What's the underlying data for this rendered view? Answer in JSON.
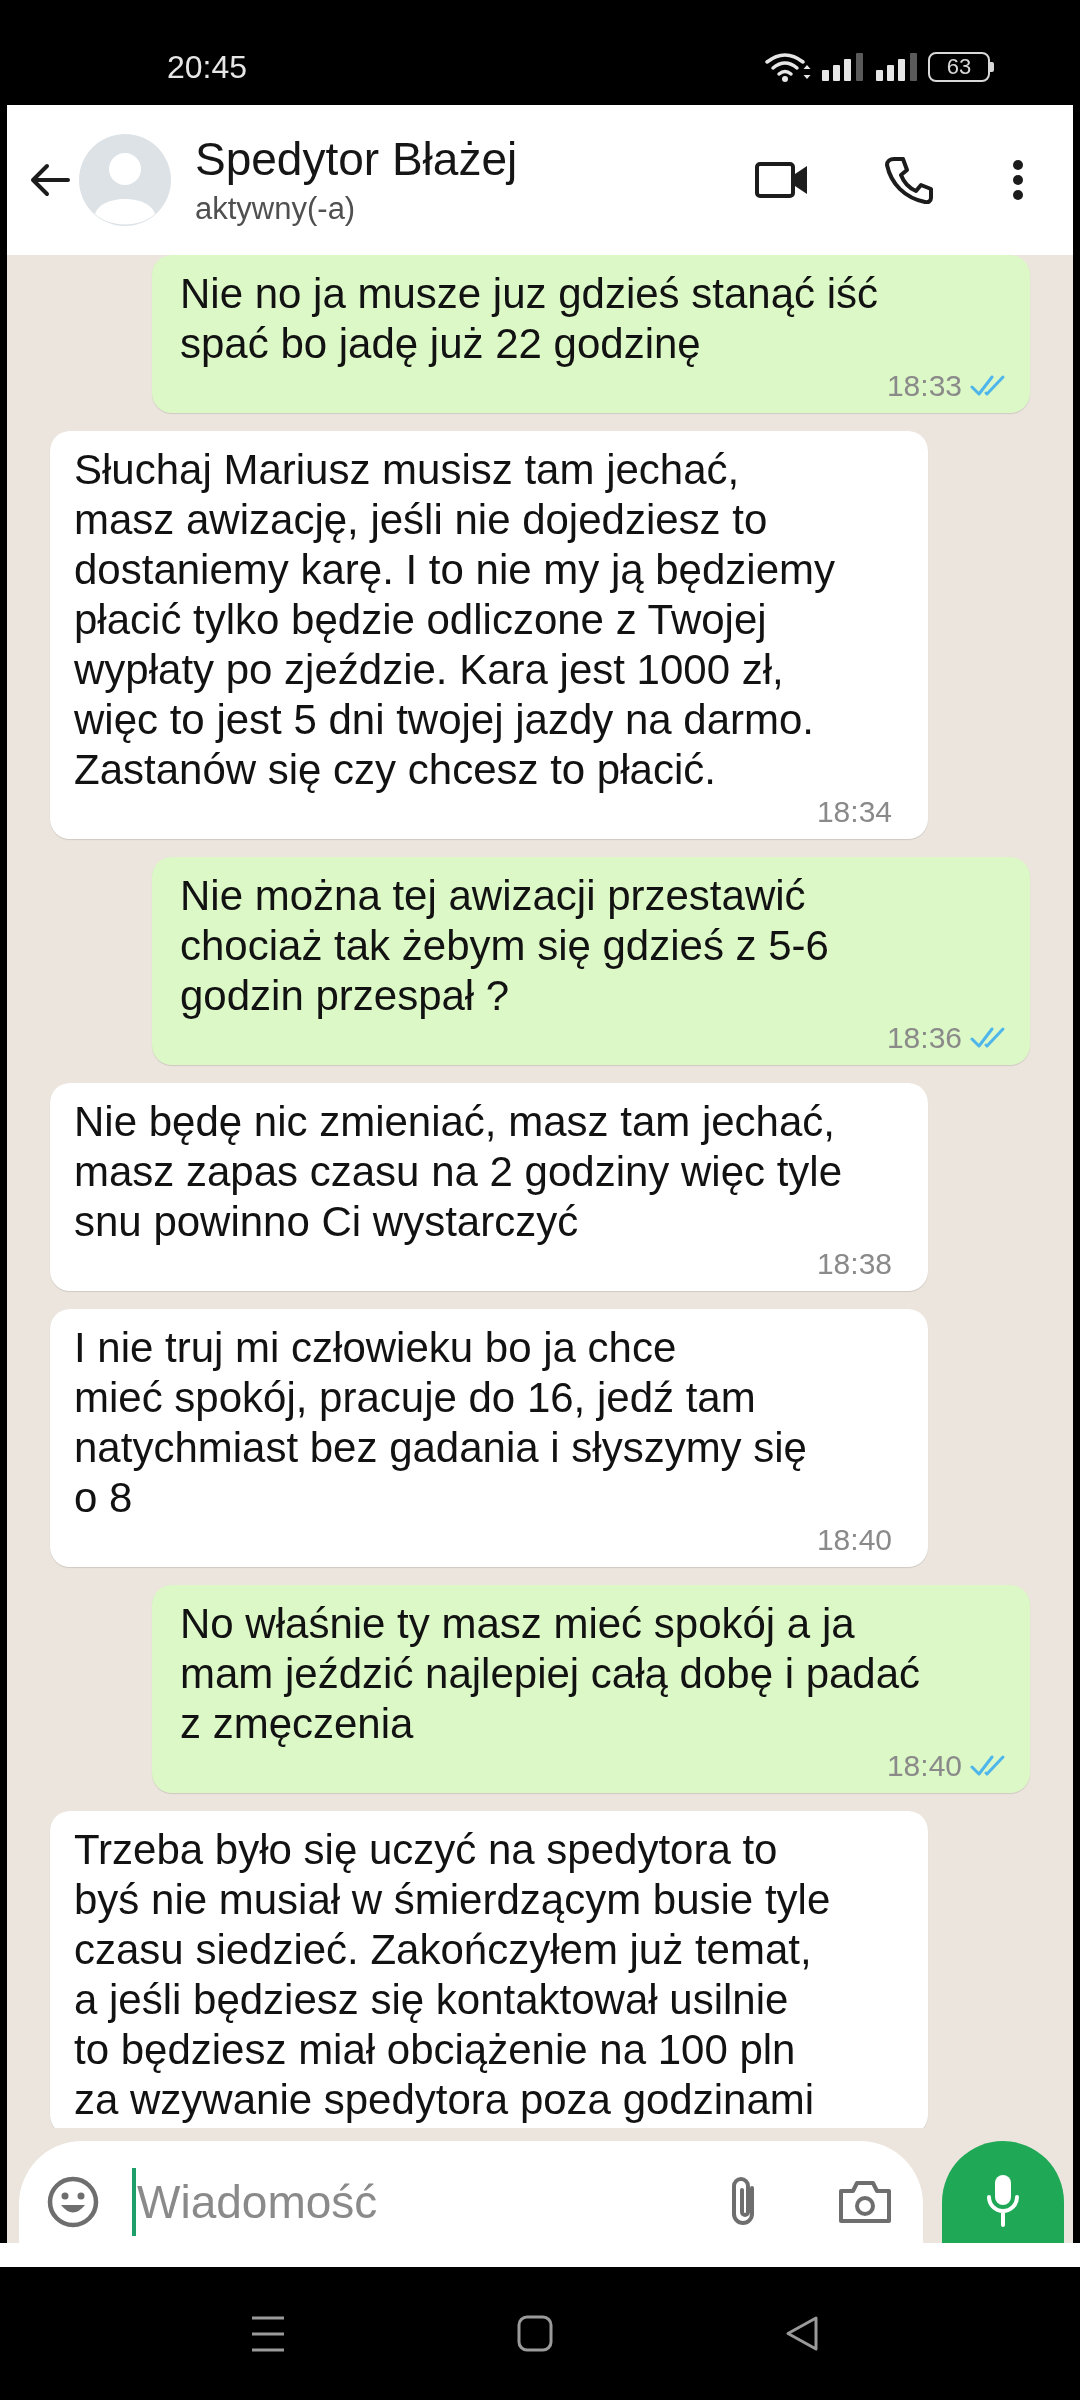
{
  "status_bar": {
    "time": "20:45",
    "battery": "63"
  },
  "header": {
    "name": "Spedytor Błażej",
    "status": "aktywny(-a)"
  },
  "messages": [
    {
      "kind": "outgoing",
      "text": "Nie no ja musze juz gdzieś stanąć iść\nspać bo jadę już 22 godzinę",
      "time": "18:33",
      "read": true
    },
    {
      "kind": "incoming",
      "text": "Słuchaj Mariusz musisz tam jechać,\nmasz awizację, jeśli nie dojedziesz to\ndostaniemy karę. I to nie my ją będziemy\npłacić tylko będzie odliczone z Twojej\nwypłaty po zjeździe. Kara jest 1000 zł,\nwięc to jest 5 dni twojej jazdy na darmo.\nZastanów się czy chcesz to płacić.",
      "time": "18:34"
    },
    {
      "kind": "outgoing",
      "text": "Nie można tej awizacji przestawić\nchociaż tak żebym się gdzieś z 5-6\ngodzin przespał ?",
      "time": "18:36",
      "read": true
    },
    {
      "kind": "incoming",
      "text": "Nie będę nic zmieniać, masz tam jechać,\nmasz zapas czasu na 2 godziny więc tyle\nsnu powinno Ci wystarczyć",
      "time": "18:38"
    },
    {
      "kind": "incoming",
      "text": "I nie truj mi człowieku bo ja chce\nmieć spokój, pracuje do 16, jedź tam\nnatychmiast bez gadania i słyszymy się\no 8",
      "time": "18:40"
    },
    {
      "kind": "outgoing",
      "text": "No właśnie ty masz mieć spokój a ja\nmam jeździć najlepiej całą dobę i padać\nz zmęczenia",
      "time": "18:40",
      "read": true
    },
    {
      "kind": "incoming",
      "text": "Trzeba było się uczyć na spedytora to\nbyś nie musiał w śmierdzącym busie tyle\nczasu siedzieć. Zakończyłem już temat,\na jeśli będziesz się kontaktował usilnie\nto będziesz miał obciążenie na 100 pln\nza wzywanie spedytora poza godzinami"
    }
  ],
  "composer": {
    "placeholder": "Wiadomość"
  }
}
